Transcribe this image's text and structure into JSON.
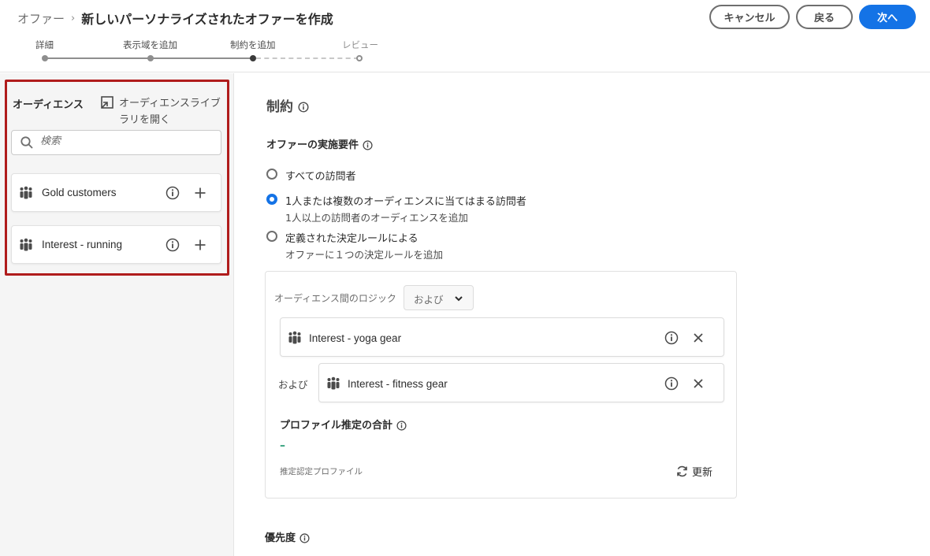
{
  "header": {
    "breadcrumb_root": "オファー",
    "breadcrumb_separator": "›",
    "title": "新しいパーソナライズされたオファーを作成",
    "buttons": {
      "cancel": "キャンセル",
      "back": "戻る",
      "next": "次へ"
    },
    "steps": [
      {
        "label": "詳細",
        "state": "done"
      },
      {
        "label": "表示域を追加",
        "state": "done"
      },
      {
        "label": "制約を追加",
        "state": "current"
      },
      {
        "label": "レビュー",
        "state": "future"
      }
    ]
  },
  "sidebar": {
    "title": "オーディエンス",
    "library_link": "オーディエンスライブラリを開く",
    "search_placeholder": "検索",
    "audiences": [
      {
        "name": "Gold customers"
      },
      {
        "name": "Interest - running"
      }
    ]
  },
  "main": {
    "title": "制約",
    "eligibility_title": "オファーの実施要件",
    "options": [
      {
        "label": "すべての訪問者",
        "sub": "",
        "checked": false
      },
      {
        "label": "1人または複数のオーディエンスに当てはまる訪問者",
        "sub": "1人以上の訪問者のオーディエンスを追加",
        "checked": true
      },
      {
        "label": "定義された決定ルールによる",
        "sub": "オファーに１つの決定ルールを追加",
        "checked": false
      }
    ],
    "logic_label": "オーディエンス間のロジック",
    "logic_value": "および",
    "and_label": "および",
    "selected_audiences": [
      {
        "name": "Interest - yoga gear"
      },
      {
        "name": "Interest - fitness gear"
      }
    ],
    "estimate_title": "プロファイル推定の合計",
    "estimate_value": "–",
    "estimate_caption": "推定認定プロファイル",
    "refresh_label": "更新",
    "priority_title": "優先度"
  },
  "colors": {
    "accent": "#1473e6",
    "highlight_border": "#b01c1c",
    "estimate_value": "#2d9d78"
  }
}
